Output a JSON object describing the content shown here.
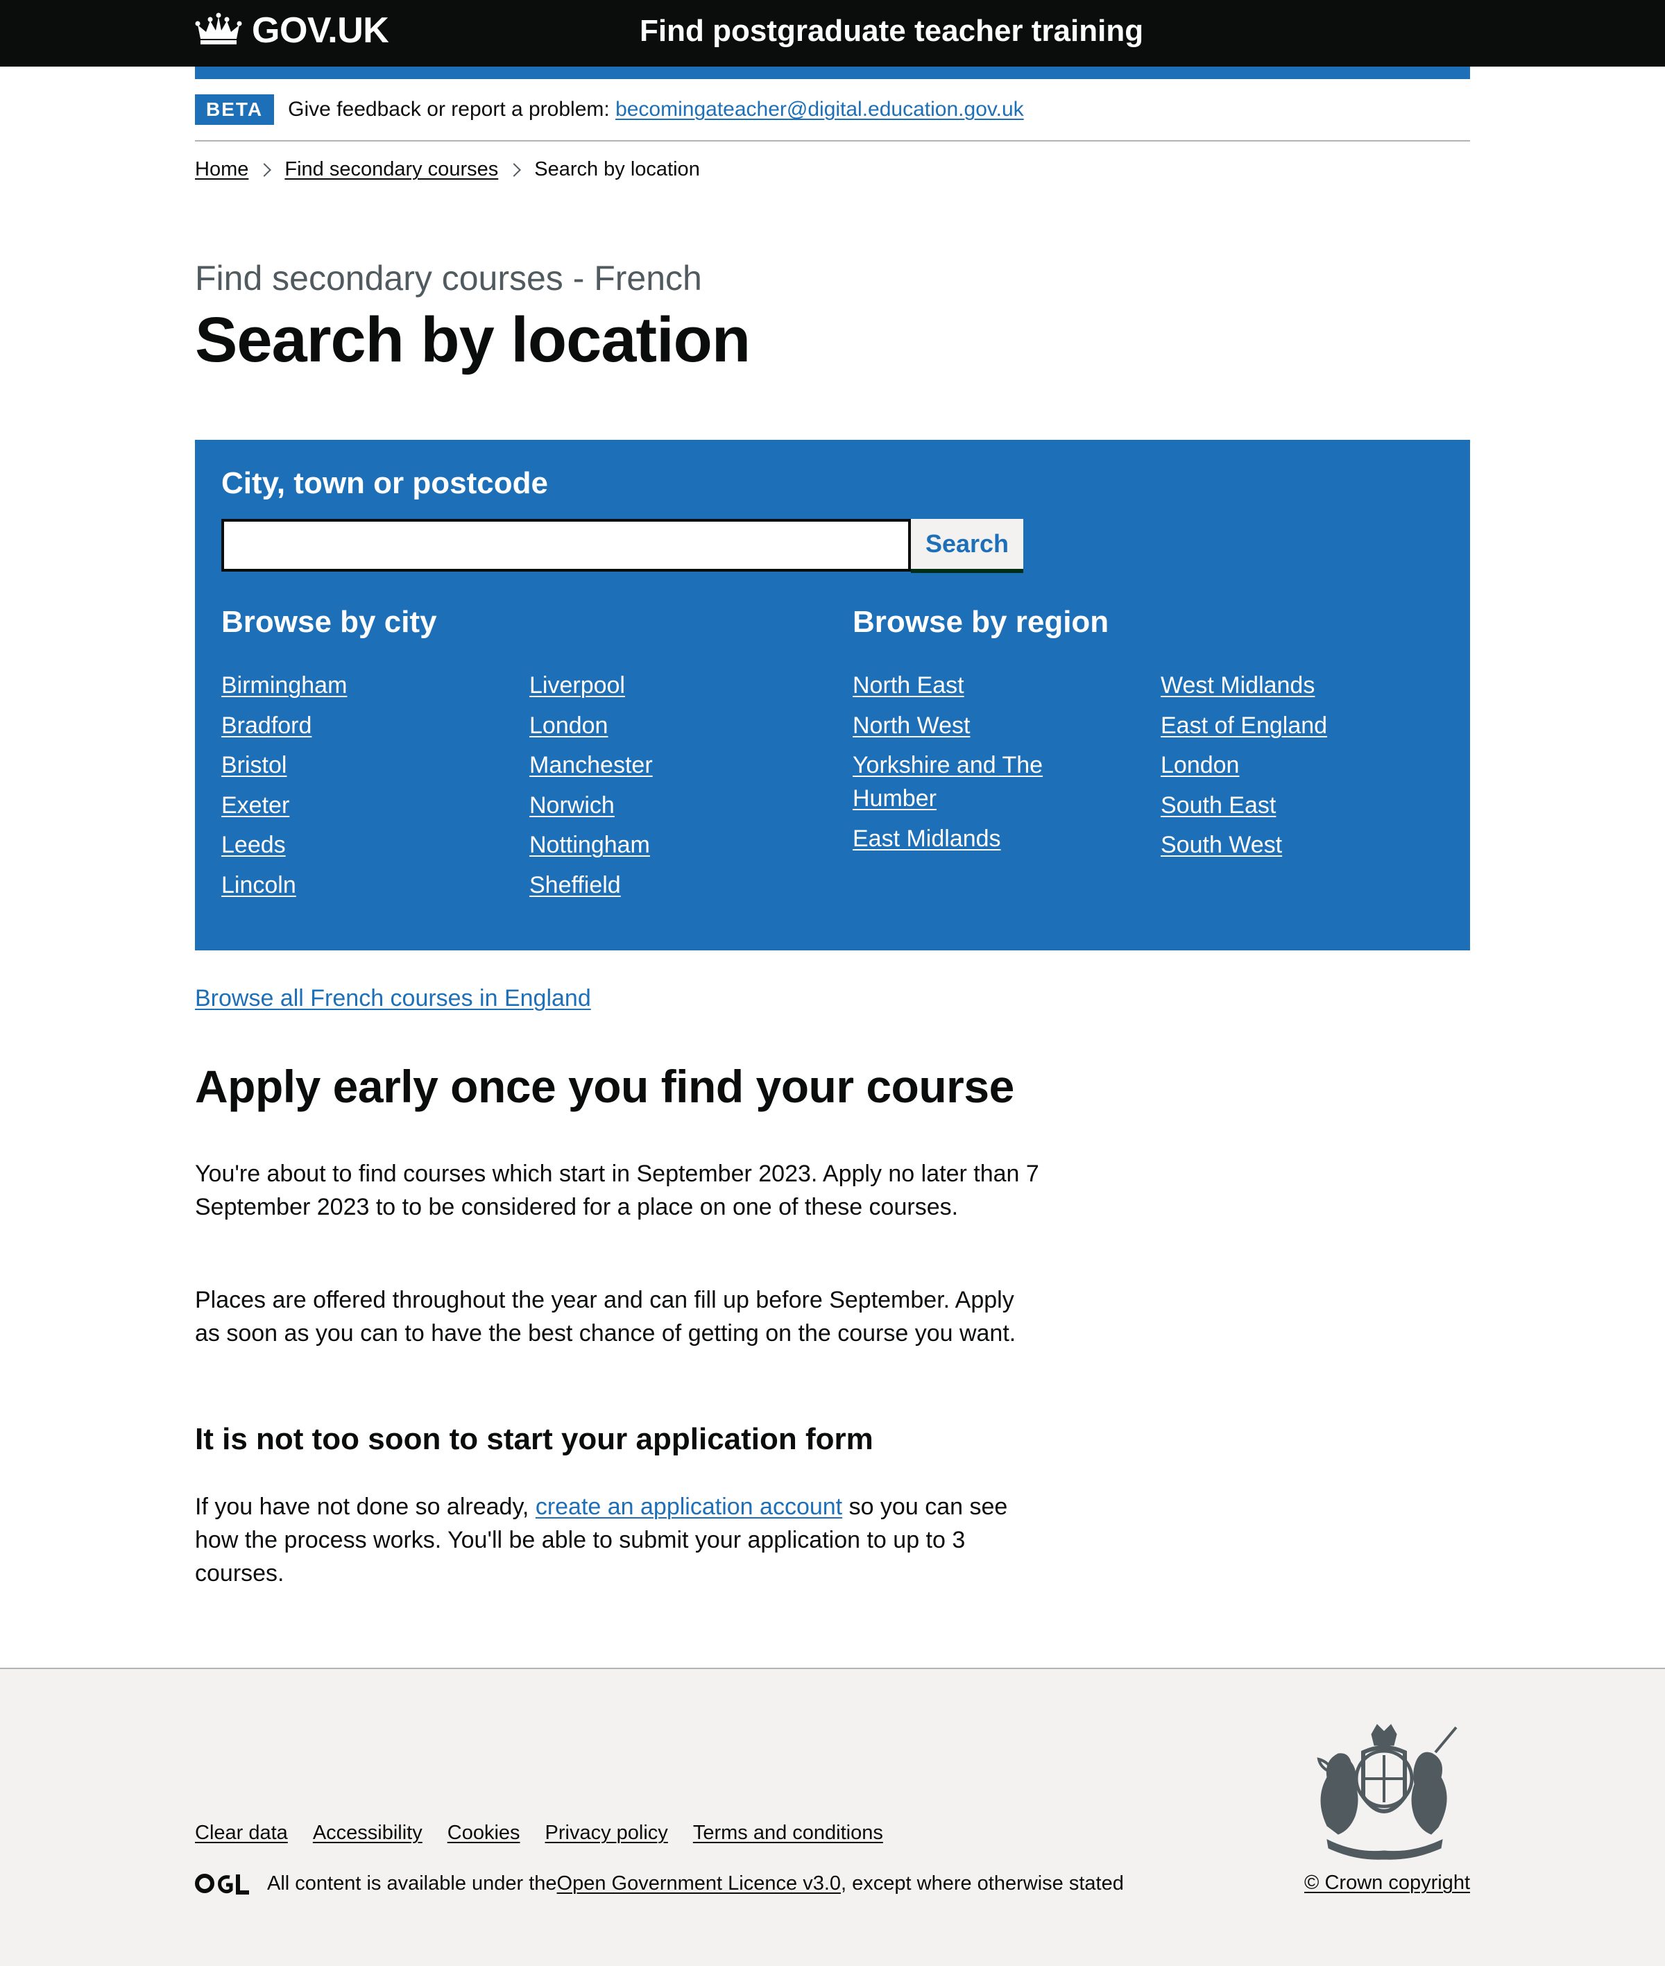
{
  "header": {
    "logo_text": "GOV.UK",
    "service_name": "Find postgraduate teacher training"
  },
  "phase_banner": {
    "tag": "BETA",
    "text": "Give feedback or report a problem: ",
    "email": "becomingateacher@digital.education.gov.uk"
  },
  "breadcrumbs": {
    "home": "Home",
    "parent": "Find secondary courses",
    "current": "Search by location"
  },
  "page": {
    "caption": "Find secondary courses - French",
    "title": "Search by location"
  },
  "search": {
    "label": "City, town or postcode",
    "value": "",
    "button": "Search"
  },
  "browse_city": {
    "heading": "Browse by city",
    "col1": [
      "Birmingham",
      "Bradford",
      "Bristol",
      "Exeter",
      "Leeds",
      "Lincoln"
    ],
    "col2": [
      "Liverpool",
      "London",
      "Manchester",
      "Norwich",
      "Nottingham",
      "Sheffield"
    ]
  },
  "browse_region": {
    "heading": "Browse by region",
    "col1": [
      "North East",
      "North West",
      "Yorkshire and The Humber",
      "East Midlands"
    ],
    "col2": [
      "West Midlands",
      "East of England",
      "London",
      "South East",
      "South West"
    ]
  },
  "browse_all": "Browse all French courses in England",
  "apply": {
    "heading": "Apply early once you find your course",
    "p1": "You're about to find courses which start in September 2023. Apply no later than 7 September 2023 to to be considered for a place on one of these courses.",
    "p2": "Places are offered throughout the year and can fill up before September. Apply as soon as you can to have the best chance of getting on the course you want.",
    "subheading": "It is not too soon to start your application form",
    "p3_before": "If you have not done so already, ",
    "p3_link": "create an application account",
    "p3_after": " so you can see how the process works. You'll be able to submit your application to up to 3 courses."
  },
  "footer": {
    "links": [
      "Clear data",
      "Accessibility",
      "Cookies",
      "Privacy policy",
      "Terms and conditions"
    ],
    "licence_before": "All content is available under the ",
    "licence_link": "Open Government Licence v3.0",
    "licence_after": ", except where otherwise stated",
    "copyright": "© Crown copyright"
  }
}
